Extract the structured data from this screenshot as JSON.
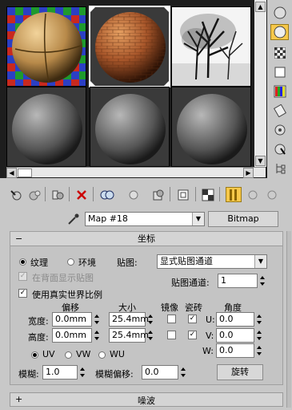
{
  "map": {
    "name": "Map #18",
    "type_button": "Bitmap"
  },
  "coordinates": {
    "title": "坐标",
    "collapse_symbol": "−",
    "texture_label": "纹理",
    "environ_label": "环境",
    "mapping_label": "贴图:",
    "mapping_value": "显式贴图通道",
    "show_map_back_label": "在背面显示贴图",
    "map_channel_label": "贴图通道:",
    "map_channel_value": "1",
    "real_world_label": "使用真实世界比例",
    "offset_header": "偏移",
    "size_header": "大小",
    "mirror_header": "镜像",
    "tile_header": "瓷砖",
    "angle_header": "角度",
    "width_label": "宽度:",
    "height_label": "高度:",
    "width_offset": "0.0mm",
    "height_offset": "0.0mm",
    "width_size": "25.4mm",
    "height_size": "25.4mm",
    "u_label": "U:",
    "v_label": "V:",
    "w_label": "W:",
    "u_angle": "0.0",
    "v_angle": "0.0",
    "w_angle": "0.0",
    "uv_label": "UV",
    "vw_label": "VW",
    "wu_label": "WU",
    "blur_label": "模糊:",
    "blur_value": "1.0",
    "blur_offset_label": "模糊偏移:",
    "blur_offset_value": "0.0",
    "rotate_button": "旋转"
  },
  "noise": {
    "title": "噪波",
    "expand_symbol": "+"
  },
  "colors": {
    "active_tool": "#f7c84a"
  }
}
